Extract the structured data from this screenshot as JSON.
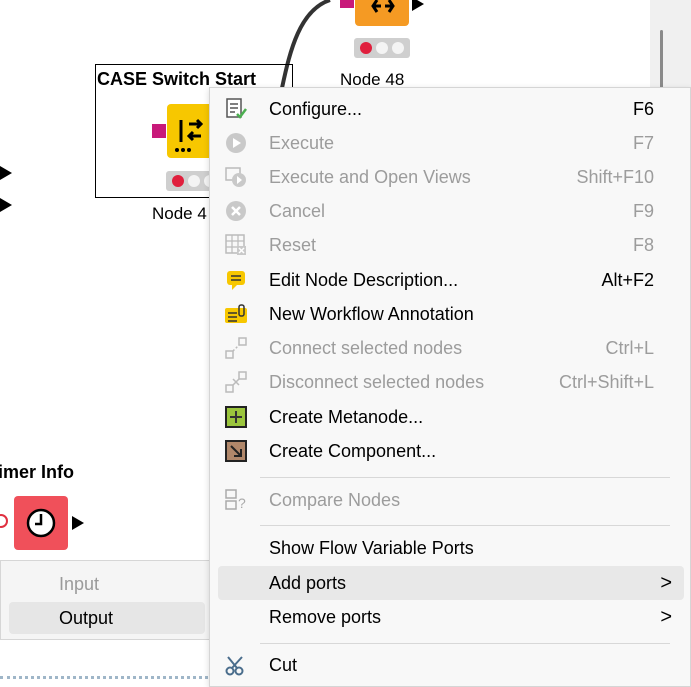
{
  "canvas": {
    "nodes": [
      {
        "title": "CASE Switch Start",
        "label": "Node 4"
      },
      {
        "title": "",
        "label": "Node 48"
      },
      {
        "title": "imer Info",
        "label": ""
      }
    ]
  },
  "port_panel": {
    "items": [
      {
        "label": "Input",
        "disabled": true
      },
      {
        "label": "Output",
        "disabled": false
      }
    ]
  },
  "context_menu": {
    "items": [
      {
        "label": "Configure...",
        "shortcut": "F6",
        "icon": "configure-icon",
        "disabled": false
      },
      {
        "label": "Execute",
        "shortcut": "F7",
        "icon": "execute-icon",
        "disabled": true
      },
      {
        "label": "Execute and Open Views",
        "shortcut": "Shift+F10",
        "icon": "execute-open-views-icon",
        "disabled": true
      },
      {
        "label": "Cancel",
        "shortcut": "F9",
        "icon": "cancel-icon",
        "disabled": true
      },
      {
        "label": "Reset",
        "shortcut": "F8",
        "icon": "reset-icon",
        "disabled": true
      },
      {
        "label": "Edit Node Description...",
        "shortcut": "Alt+F2",
        "icon": "edit-description-icon",
        "disabled": false
      },
      {
        "label": "New Workflow Annotation",
        "shortcut": "",
        "icon": "annotation-icon",
        "disabled": false
      },
      {
        "label": "Connect selected nodes",
        "shortcut": "Ctrl+L",
        "icon": "connect-nodes-icon",
        "disabled": true
      },
      {
        "label": "Disconnect selected nodes",
        "shortcut": "Ctrl+Shift+L",
        "icon": "disconnect-nodes-icon",
        "disabled": true
      },
      {
        "label": "Create Metanode...",
        "shortcut": "",
        "icon": "metanode-icon",
        "disabled": false
      },
      {
        "label": "Create Component...",
        "shortcut": "",
        "icon": "component-icon",
        "disabled": false
      },
      {
        "label": "Compare Nodes",
        "shortcut": "",
        "icon": "compare-nodes-icon",
        "disabled": true
      },
      {
        "label": "Show Flow Variable Ports",
        "shortcut": "",
        "icon": "",
        "disabled": false
      },
      {
        "label": "Add ports",
        "shortcut": "",
        "icon": "",
        "disabled": false,
        "submenu": true
      },
      {
        "label": "Remove ports",
        "shortcut": "",
        "icon": "",
        "disabled": false,
        "submenu": true
      },
      {
        "label": "Cut",
        "shortcut": "",
        "icon": "scissors-icon",
        "disabled": false
      }
    ],
    "submenu_glyph": ">"
  },
  "colors": {
    "node_yellow": "#f7c700",
    "node_orange": "#f59a23",
    "node_red": "#f0505a",
    "port_magenta": "#c8197a",
    "menu_bg": "#f8f8f8"
  }
}
